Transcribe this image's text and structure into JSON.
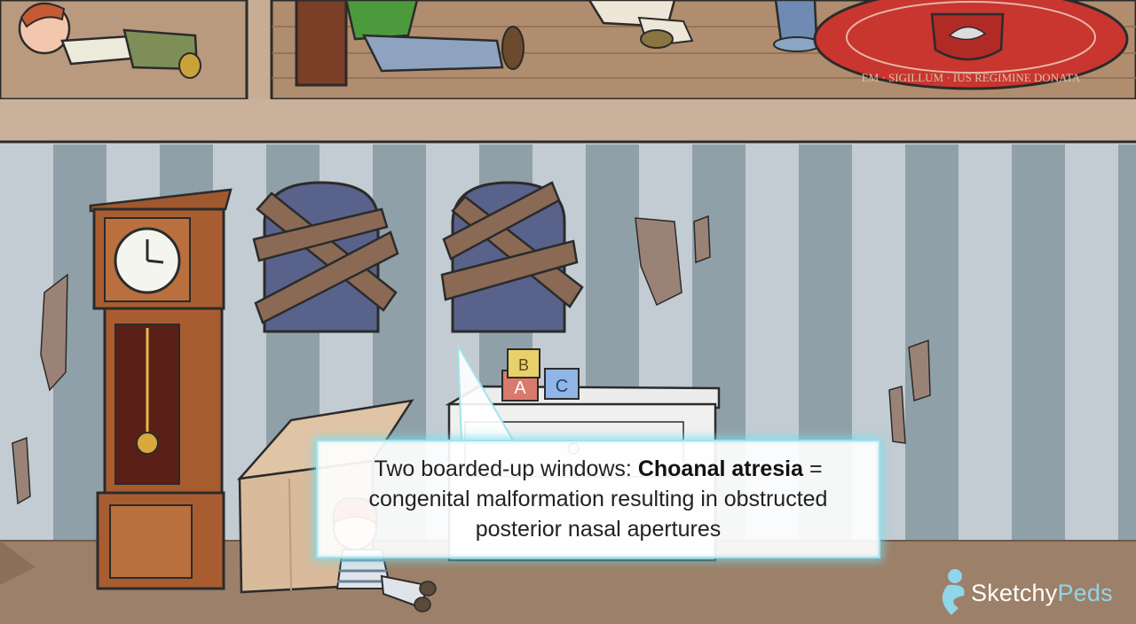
{
  "callout": {
    "prefix": "Two boarded-up windows: ",
    "term": "Choanal atresia",
    "suffix": " = congenital malformation resulting in obstructed posterior nasal apertures"
  },
  "blocks": [
    "A",
    "B",
    "C"
  ],
  "rug_text": "EM · SIGILLUM · IUS REGIMINE DONATA",
  "brand": {
    "part1": "Sketchy",
    "part2": "Peds"
  },
  "colors": {
    "accent": "#8fd6ea",
    "callout_border": "#9fe3ee",
    "wall_stripe_a": "#b9c3ca",
    "wall_stripe_b": "#8f9ea6",
    "floor": "#9b7f6a"
  }
}
